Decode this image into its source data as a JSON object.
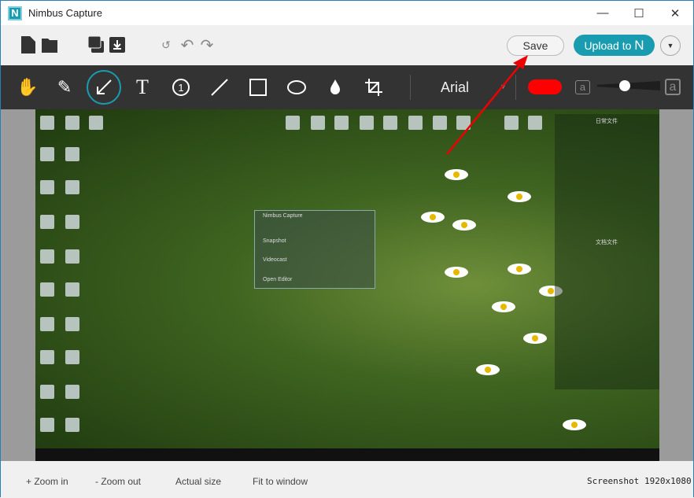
{
  "window": {
    "title": "Nimbus Capture",
    "logo_letter": "N"
  },
  "toolbar": {
    "save_label": "Save",
    "upload_label": "Upload to",
    "upload_brand": "N"
  },
  "drawing": {
    "font": "Arial",
    "color": "#ff0000",
    "size_small": "a",
    "size_large": "a",
    "thickness_level": 0.4,
    "active_tool": "arrow",
    "numbered_tool": "1",
    "text_tool": "T"
  },
  "canvas": {
    "mini_window_title": "Nimbus Capture",
    "mini_items": [
      "Snapshot",
      "Videocast",
      "Open Editor"
    ],
    "panel_title": "日常文件",
    "panel_title2": "文档文件"
  },
  "bottom": {
    "zoom_in": "+ Zoom in",
    "zoom_out": "- Zoom out",
    "actual_size": "Actual size",
    "fit_window": "Fit to window",
    "type": "Screenshot",
    "dimensions": "1920x1080"
  },
  "colors": {
    "accent": "#1a9cb0",
    "annotation": "#ff0000"
  }
}
